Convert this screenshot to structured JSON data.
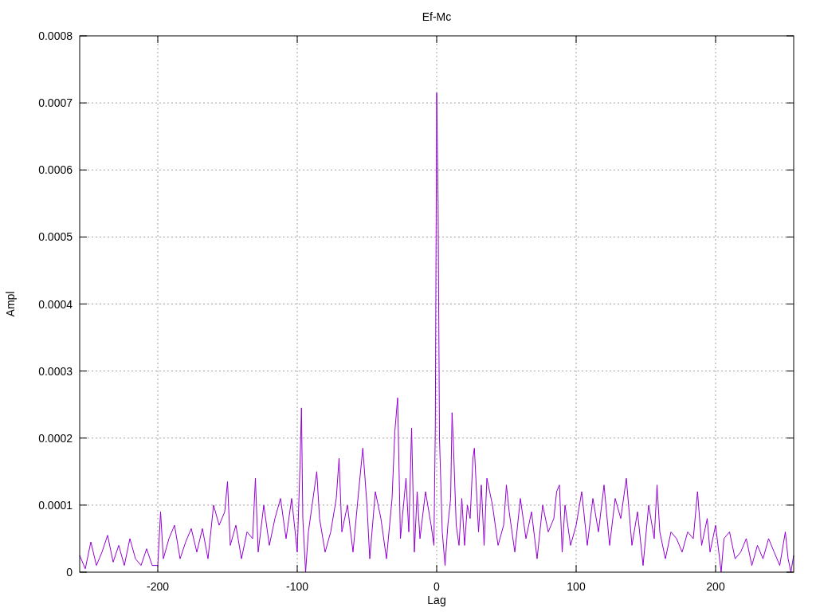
{
  "chart_data": {
    "type": "line",
    "grid": true,
    "title": "Ef-Mc",
    "xlabel": "Lag",
    "ylabel": "Ampl",
    "xlim": [
      -256,
      256
    ],
    "ylim": [
      0,
      0.0008
    ],
    "xticks": [
      -200,
      -100,
      0,
      100,
      200
    ],
    "yticks": [
      0,
      0.0001,
      0.0002,
      0.0003,
      0.0004,
      0.0005,
      0.0006,
      0.0007,
      0.0008
    ],
    "x": [
      -256,
      -252,
      -248,
      -244,
      -240,
      -236,
      -232,
      -228,
      -224,
      -220,
      -216,
      -212,
      -208,
      -204,
      -200,
      -198,
      -196,
      -192,
      -188,
      -184,
      -180,
      -176,
      -172,
      -168,
      -164,
      -160,
      -156,
      -152,
      -150,
      -148,
      -144,
      -140,
      -136,
      -132,
      -130,
      -128,
      -124,
      -120,
      -116,
      -112,
      -108,
      -104,
      -100,
      -98,
      -97,
      -96,
      -94,
      -92,
      -88,
      -86,
      -84,
      -80,
      -76,
      -72,
      -70,
      -68,
      -64,
      -60,
      -56,
      -53,
      -50,
      -48,
      -44,
      -40,
      -36,
      -32,
      -30,
      -28,
      -26,
      -22,
      -20,
      -18,
      -16,
      -14,
      -12,
      -8,
      -4,
      -2,
      -1,
      0,
      1,
      2,
      4,
      6,
      8,
      10,
      11,
      12,
      14,
      16,
      18,
      20,
      22,
      24,
      26,
      27,
      30,
      32,
      34,
      36,
      40,
      44,
      48,
      50,
      52,
      56,
      60,
      64,
      68,
      72,
      76,
      80,
      84,
      86,
      88,
      90,
      92,
      96,
      100,
      104,
      108,
      112,
      116,
      120,
      124,
      128,
      132,
      136,
      138,
      140,
      144,
      148,
      152,
      156,
      158,
      160,
      164,
      168,
      172,
      176,
      180,
      184,
      187,
      190,
      194,
      196,
      200,
      204,
      206,
      210,
      214,
      218,
      222,
      226,
      230,
      234,
      238,
      242,
      246,
      250,
      252,
      254,
      256
    ],
    "series": [
      {
        "color": "#9400d3",
        "values": [
          2.5e-05,
          5e-06,
          4.5e-05,
          1e-05,
          3e-05,
          5.5e-05,
          1.5e-05,
          4e-05,
          1e-05,
          5e-05,
          2e-05,
          1e-05,
          3.5e-05,
          1e-05,
          1e-05,
          9e-05,
          2e-05,
          5e-05,
          7e-05,
          2e-05,
          4.5e-05,
          6.5e-05,
          3e-05,
          6.5e-05,
          2e-05,
          0.0001,
          7e-05,
          9e-05,
          0.000135,
          4e-05,
          7e-05,
          2e-05,
          6e-05,
          5e-05,
          0.00014,
          3e-05,
          0.0001,
          4e-05,
          8e-05,
          0.00011,
          5e-05,
          0.00011,
          3e-05,
          0.00016,
          0.000245,
          8e-05,
          0,
          6e-05,
          0.00012,
          0.00015,
          8e-05,
          3e-05,
          6e-05,
          0.00011,
          0.00017,
          6e-05,
          0.0001,
          3e-05,
          0.00012,
          0.000185,
          0.0001,
          2e-05,
          0.00012,
          8e-05,
          2e-05,
          0.00011,
          0.00021,
          0.00026,
          5e-05,
          0.00014,
          6e-05,
          0.000215,
          3e-05,
          0.00012,
          5e-05,
          0.00012,
          7e-05,
          4e-05,
          0.00022,
          0.000715,
          0.00055,
          0.0002,
          6e-05,
          1e-05,
          7e-05,
          0.00011,
          0.000238,
          0.00019,
          7e-05,
          4e-05,
          0.00011,
          4e-05,
          0.0001,
          8e-05,
          0.00017,
          0.000185,
          6e-05,
          0.00013,
          4e-05,
          0.00014,
          0.0001,
          4e-05,
          7e-05,
          0.00013,
          9e-05,
          3e-05,
          0.00011,
          5e-05,
          9e-05,
          2e-05,
          0.0001,
          6e-05,
          8e-05,
          0.00012,
          0.00013,
          3e-05,
          0.0001,
          4e-05,
          7e-05,
          0.00012,
          4e-05,
          0.00011,
          6e-05,
          0.00013,
          4e-05,
          0.00011,
          8e-05,
          0.00014,
          9e-05,
          4e-05,
          9e-05,
          1e-05,
          0.0001,
          5e-05,
          0.00013,
          6e-05,
          2e-05,
          6e-05,
          5e-05,
          3e-05,
          6e-05,
          5e-05,
          0.00012,
          4e-05,
          8e-05,
          3e-05,
          7e-05,
          0,
          5e-05,
          6e-05,
          2e-05,
          3e-05,
          5e-05,
          1e-05,
          4e-05,
          2e-05,
          5e-05,
          3e-05,
          1e-05,
          6e-05,
          2e-05,
          0,
          2.5e-05
        ]
      }
    ]
  }
}
